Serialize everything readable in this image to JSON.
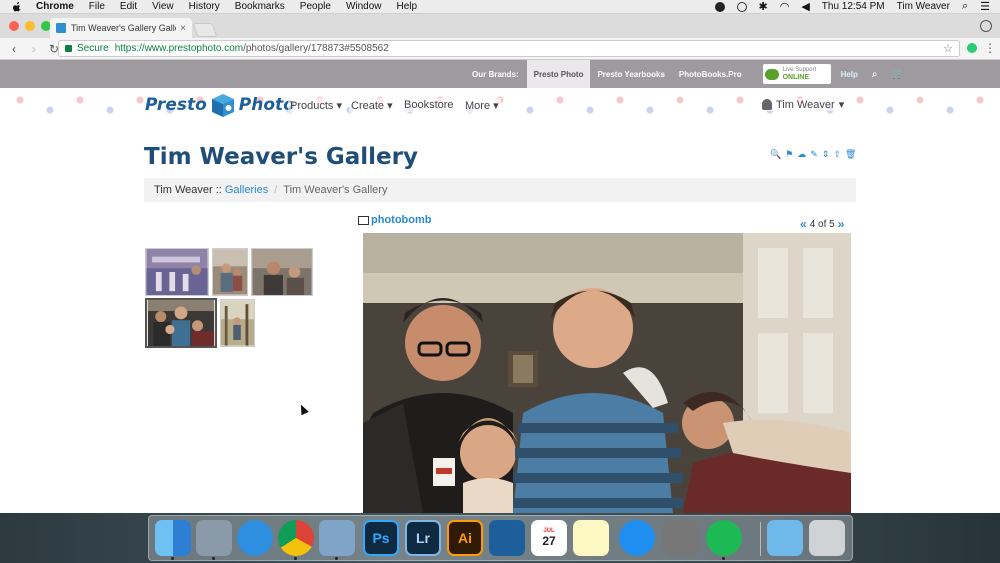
{
  "menubar": {
    "app": "Chrome",
    "items": [
      "File",
      "Edit",
      "View",
      "History",
      "Bookmarks",
      "People",
      "Window",
      "Help"
    ],
    "clock": "Thu 12:54 PM",
    "user": "Tim Weaver"
  },
  "browser": {
    "tab_title": "Tim Weaver's Gallery Gallery",
    "tab_close": "×",
    "secure_label": "Secure",
    "url_host": "https://www.prestophoto.com",
    "url_path": "/photos/gallery/178873#5508562",
    "back_icon": "‹",
    "forward_icon": "›",
    "reload_icon": "↻",
    "star_icon": "☆",
    "menu_icon": "⋮"
  },
  "brandbar": {
    "our_brands_label": "Our Brands:",
    "brands": [
      "Presto Photo",
      "Presto Yearbooks",
      "PhotoBooks.Pro"
    ],
    "live_support_line1": "Live Support",
    "live_support_line2": "ONLINE",
    "help_label": "Help",
    "search_icon": "⌕",
    "cart_icon": "🛒"
  },
  "nav": {
    "logo_left": "Presto",
    "logo_right": "Photo",
    "items": [
      "Products ▾",
      "Create ▾",
      "Bookstore",
      "More ▾"
    ],
    "user_label": "Tim Weaver",
    "user_caret": "▾"
  },
  "gallery": {
    "title": "Tim Weaver's Gallery",
    "tools": [
      "🔍",
      "⚑",
      "☁",
      "✎",
      "⇕",
      "⇧",
      "🗑"
    ],
    "breadcrumb_user": "Tim Weaver",
    "breadcrumb_sep": "::",
    "breadcrumb_galleries": "Galleries",
    "breadcrumb_slash": "/",
    "breadcrumb_current": "Tim Weaver's Gallery",
    "photo_title": "photobomb",
    "pager_prev": "«",
    "pager_text": "4 of 5",
    "pager_next": "»",
    "selected_thumb": 4
  },
  "dock": {
    "apps": [
      "Finder",
      "Image Capture",
      "Safari",
      "Chrome",
      "Preview",
      "Photoshop",
      "Lightroom",
      "Illustrator",
      "Keynote",
      "Calendar",
      "Notes",
      "App Store",
      "System Preferences",
      "Spotify",
      "Downloads",
      "Trash"
    ],
    "ps_label": "Ps",
    "lr_label": "Lr",
    "ai_label": "Ai",
    "calendar_month": "JUL",
    "calendar_day": "27"
  }
}
